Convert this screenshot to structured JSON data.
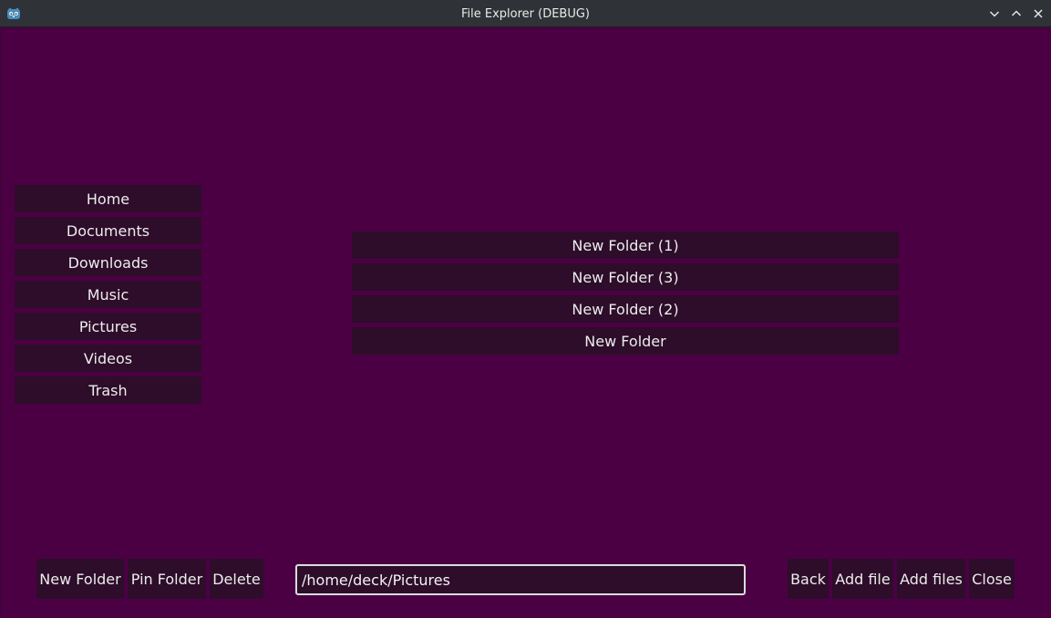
{
  "window": {
    "title": "File Explorer (DEBUG)",
    "app_icon": "godot-icon",
    "controls": [
      "chevron-down-icon",
      "chevron-up-icon",
      "close-icon"
    ]
  },
  "sidebar": {
    "items": [
      {
        "label": "Home"
      },
      {
        "label": "Documents"
      },
      {
        "label": "Downloads"
      },
      {
        "label": "Music"
      },
      {
        "label": "Pictures"
      },
      {
        "label": "Videos"
      },
      {
        "label": "Trash"
      }
    ]
  },
  "folders": {
    "items": [
      {
        "label": "New Folder (1)"
      },
      {
        "label": "New Folder (3)"
      },
      {
        "label": "New Folder (2)"
      },
      {
        "label": "New Folder"
      }
    ]
  },
  "toolbar": {
    "new_folder_label": "New Folder",
    "pin_folder_label": "Pin Folder",
    "delete_label": "Delete",
    "path_value": "/home/deck/Pictures",
    "back_label": "Back",
    "add_file_label": "Add file",
    "add_files_label": "Add files",
    "close_label": "Close"
  },
  "colors": {
    "background": "#4b0044",
    "button": "#2d0d2a",
    "titlebar": "#2f3236",
    "text": "#ececec"
  }
}
